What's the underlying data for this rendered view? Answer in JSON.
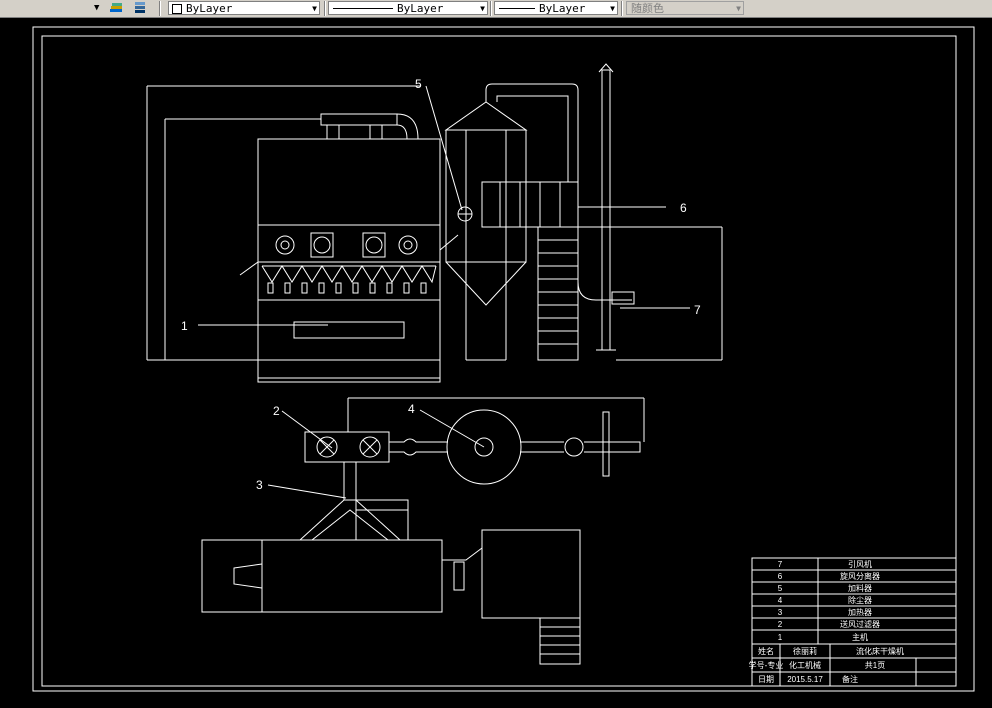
{
  "toolbar": {
    "layer_combo1": "ByLayer",
    "layer_combo2": "ByLayer",
    "layer_combo3": "ByLayer",
    "color_combo": "随颜色"
  },
  "drawing": {
    "labels": [
      "1",
      "2",
      "3",
      "4",
      "5",
      "6",
      "7"
    ],
    "title_block": {
      "rows": [
        {
          "no": "7",
          "name": "引风机"
        },
        {
          "no": "6",
          "name": "旋风分离器"
        },
        {
          "no": "5",
          "name": "加料器"
        },
        {
          "no": "4",
          "name": "除尘器"
        },
        {
          "no": "3",
          "name": "加热器"
        },
        {
          "no": "2",
          "name": "送风过滤器"
        },
        {
          "no": "1",
          "name": "主机"
        }
      ],
      "name_label": "姓名",
      "name_value": "徐丽莉",
      "title_value": "流化床干燥机",
      "id_label": "学号-专业",
      "id_value": "化工机械",
      "sheet_value": "共1页",
      "date_label": "日期",
      "date_value": "2015.5.17",
      "remark_label": "备注"
    },
    "colors": {
      "line": "#ffffff",
      "background": "#000000"
    }
  }
}
